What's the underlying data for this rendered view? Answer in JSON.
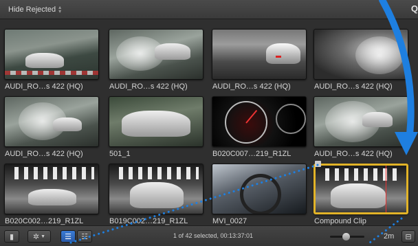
{
  "topbar": {
    "filter_label": "Hide Rejected",
    "search_glyph": "Q"
  },
  "clips": [
    {
      "name": "AUDI_RO…s 422 (HQ)",
      "thumb": "track"
    },
    {
      "name": "AUDI_RO…s 422 (HQ)",
      "thumb": "wet"
    },
    {
      "name": "AUDI_RO…s 422 (HQ)",
      "thumb": "rear"
    },
    {
      "name": "AUDI_RO…s 422 (HQ)",
      "thumb": "interior"
    },
    {
      "name": "AUDI_RO…s 422 (HQ)",
      "thumb": "wet"
    },
    {
      "name": "501_1",
      "thumb": "green"
    },
    {
      "name": "B020C007…219_R1ZL",
      "thumb": "gauge"
    },
    {
      "name": "AUDI_RO…s 422 (HQ)",
      "thumb": "wet"
    },
    {
      "name": "B020C002…219_R1ZL",
      "thumb": "studio"
    },
    {
      "name": "B019C002…219_R1ZL",
      "thumb": "studio"
    },
    {
      "name": "MVI_0027",
      "thumb": "steer"
    },
    {
      "name": "Compound Clip",
      "thumb": "studio",
      "selected": true
    }
  ],
  "bottombar": {
    "status": "1 of 42 selected, 00:13:37:01",
    "duration_label": "2m",
    "zoom_level": 0.45
  },
  "colors": {
    "selection": "#e2b327",
    "annotation_blue": "#1e7fe0",
    "playhead": "#e33333"
  },
  "icons": [
    "stepper-icon",
    "search-icon",
    "filmstrip-toggle-icon",
    "gear-icon",
    "list-view-icon",
    "filmstrip-view-icon",
    "clip-appearance-icon",
    "compound-clip-icon"
  ]
}
